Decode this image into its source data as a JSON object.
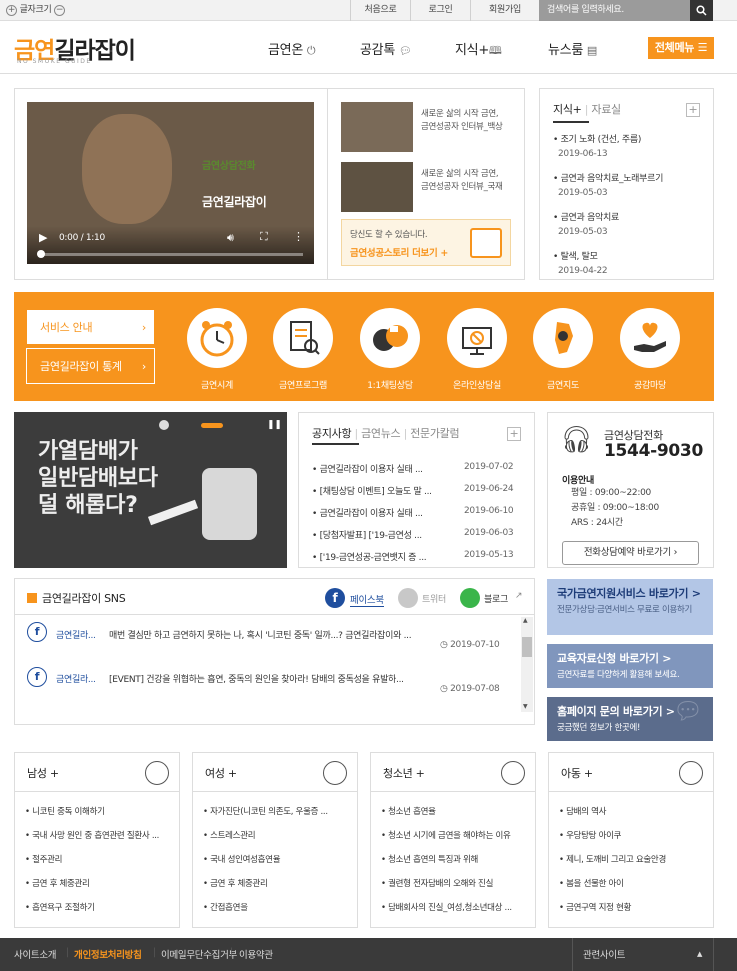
{
  "topbar": {
    "font_size_label": "글자크기",
    "links": [
      "처음으로",
      "로그인",
      "회원가입"
    ],
    "search_placeholder": "검색어를 입력하세요."
  },
  "header": {
    "logo_text_1": "금연",
    "logo_text_2": "길라잡이",
    "logo_sub": "NO SMOKE GUIDE",
    "nav": [
      "금연온",
      "공감톡",
      "지식+",
      "뉴스룸"
    ],
    "all_menu": "전체메뉴"
  },
  "video": {
    "time": "0:00 / 1:10",
    "sign_title": "금연상담전화",
    "sign_brand": "금연길라잡이"
  },
  "interviews": [
    {
      "title": "새로운 삶의 시작 금연,",
      "sub": "금연성공자 인터뷰_백상"
    },
    {
      "title": "새로운 삶의 시작 금연,",
      "sub": "금연성공자 인터뷰_국재"
    }
  ],
  "story": {
    "line1": "당신도 할 수 있습니다.",
    "line2": "금연성공스토리 더보기 +"
  },
  "knowledge": {
    "tab_active": "지식+",
    "tab_other": "자료실",
    "items": [
      {
        "title": "조기 노화 (건선, 주름)",
        "date": "2019-06-13"
      },
      {
        "title": "금연과 음악치료_노래부르기",
        "date": "2019-05-03"
      },
      {
        "title": "금연과 음악치료",
        "date": "2019-05-03"
      },
      {
        "title": "탈색, 탈모",
        "date": "2019-04-22"
      }
    ]
  },
  "services": {
    "btn1": "서비스 안내",
    "btn2": "금연길라잡이 통계",
    "icons": [
      {
        "label": "금연시계",
        "icon": "alarm-clock-icon"
      },
      {
        "label": "금연프로그램",
        "icon": "clipboard-search-icon"
      },
      {
        "label": "1:1채팅상담",
        "icon": "chat-heads-icon"
      },
      {
        "label": "온라인상담실",
        "icon": "monitor-no-smoking-icon"
      },
      {
        "label": "금연지도",
        "icon": "map-pin-icon"
      },
      {
        "label": "공감마당",
        "icon": "hand-heart-icon"
      }
    ]
  },
  "banner": {
    "line1": "가열담배가",
    "line2": "일반담배보다",
    "line3": "덜 해롭다?"
  },
  "notice": {
    "tabs": [
      "공지사항",
      "금연뉴스",
      "전문가칼럼"
    ],
    "items": [
      {
        "title": "금연길라잡이 이용자 실태 ...",
        "date": "2019-07-02"
      },
      {
        "title": "[채팅상담 이벤트] 오늘도 말 ...",
        "date": "2019-06-24"
      },
      {
        "title": "금연길라잡이 이용자 실태 ...",
        "date": "2019-06-10"
      },
      {
        "title": "[당첨자발표] ['19-금연성 ...",
        "date": "2019-06-03"
      },
      {
        "title": "['19-금연성공-금연뱃지 증 ...",
        "date": "2019-05-13"
      }
    ]
  },
  "call": {
    "title": "금연상담전화",
    "number": "1544-9030",
    "guide": "이용안내",
    "hours": [
      "평일 : 09:00~22:00",
      "공휴일 : 09:00~18:00",
      "ARS : 24시간"
    ],
    "button": "전화상담예약 바로가기"
  },
  "sns": {
    "title": "금연길라잡이 SNS",
    "tabs": [
      "페이스북",
      "트위터",
      "블로그"
    ],
    "posts": [
      {
        "author": "금연길라...",
        "text": "매번 결심만 하고 금연하지 못하는 나, 혹시 '니코틴 중독' 일까...? 금연길라잡이와 ...",
        "date": "2019-07-10"
      },
      {
        "author": "금연길라...",
        "text": "[EVENT] 건강을 위협하는 흡연, 중독의 원인을 찾아라! 담배의 중독성을 유발하...",
        "date": "2019-07-08"
      }
    ]
  },
  "promos": [
    {
      "title": "국가금연지원서비스 바로가기 >",
      "desc": "전문가상담·금연서비스 무료로 이용하기",
      "color": "#b3c6e6"
    },
    {
      "title": "교육자료신청 바로가기 >",
      "desc": "금연자료를 다양하게 활용해 보세요.",
      "color": "#8096bd"
    },
    {
      "title": "홈페이지 문의 바로가기 >",
      "desc": "궁금했던 정보가 한곳에!",
      "color": "#5b6c8c"
    }
  ],
  "categories": [
    {
      "title": "남성 +",
      "items": [
        "니코틴 중독 이해하기",
        "국내 사망 원인 중 흡연관련 질환사 ...",
        "절주관리",
        "금연 후 체중관리",
        "흡연욕구 조절하기"
      ]
    },
    {
      "title": "여성 +",
      "items": [
        "자가진단(니코틴 의존도, 우울증 ...",
        "스트레스관리",
        "국내 성인여성흡연율",
        "금연 후 체중관리",
        "간접흡연을"
      ]
    },
    {
      "title": "청소년 +",
      "items": [
        "청소년 흡연율",
        "청소년 시기에 금연을 해야하는 이유",
        "청소년 흡연의 특징과 위해",
        "궐련형 전자담배의 오해와 진실",
        "담배회사의 진실_여성,청소년대상 ..."
      ]
    },
    {
      "title": "아동 +",
      "items": [
        "담배의 역사",
        "우당탕탕 아이쿠",
        "제니, 도깨비 그리고 요술안경",
        "봄을 선물한 아이",
        "금연구역 지정 현황"
      ]
    }
  ],
  "footer": {
    "links": [
      "사이트소개",
      "개인정보처리방침",
      "이메일무단수집거부",
      "이용약관"
    ],
    "related": "관련사이트"
  },
  "colors": {
    "accent": "#f7941d"
  }
}
